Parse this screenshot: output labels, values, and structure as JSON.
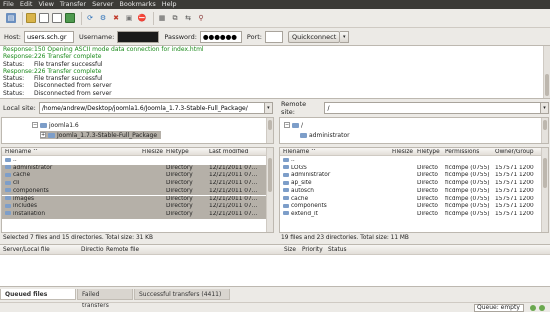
{
  "menu": [
    "File",
    "Edit",
    "View",
    "Transfer",
    "Server",
    "Bookmarks",
    "Help"
  ],
  "toolbar_icons": [
    "site-manager-icon",
    "toggle-log-icon",
    "toggle-local-tree-icon",
    "toggle-remote-tree-icon",
    "toggle-queue-icon",
    "refresh-icon",
    "process-queue-icon",
    "cancel-icon",
    "disconnect-icon",
    "reconnect-icon",
    "filter-icon",
    "compare-icon",
    "sync-browse-icon",
    "search-icon"
  ],
  "quickconnect": {
    "host_label": "Host:",
    "host_value": "users.sch.gr",
    "username_label": "Username:",
    "username_value": "",
    "password_label": "Password:",
    "password_value": "●●●●●●",
    "port_label": "Port:",
    "port_value": "",
    "button_label": "Quickconnect",
    "dropdown": "▾"
  },
  "log": [
    {
      "type": "Response:",
      "text": "150 Opening ASCII mode data connection for index.html",
      "color": "green"
    },
    {
      "type": "Response:",
      "text": "226 Transfer complete",
      "color": "green"
    },
    {
      "type": "Status:",
      "text": "File transfer successful",
      "color": "plain"
    },
    {
      "type": "Response:",
      "text": "226 Transfer complete",
      "color": "green"
    },
    {
      "type": "Status:",
      "text": "File transfer successful",
      "color": "plain"
    },
    {
      "type": "Status:",
      "text": "Disconnected from server",
      "color": "plain"
    },
    {
      "type": "Status:",
      "text": "Disconnected from server",
      "color": "plain"
    }
  ],
  "local": {
    "label": "Local site:",
    "path": "/home/andrew/Desktop/joomla1.6/Joomla_1.7.3-Stable-Full_Package/",
    "tree": [
      {
        "name": "joomla1.6",
        "expander": "−"
      },
      {
        "name": "Joomla_1.7.3-Stable-Full_Package",
        "expander": "+"
      }
    ],
    "columns": [
      "Filename ^",
      "Filesize",
      "Filetype",
      "Last modified"
    ],
    "parent": "..",
    "rows": [
      {
        "name": "administrator",
        "type": "Directory",
        "modified": "12/21/2011 07..."
      },
      {
        "name": "cache",
        "type": "Directory",
        "modified": "12/21/2011 07..."
      },
      {
        "name": "cli",
        "type": "Directory",
        "modified": "12/21/2011 07..."
      },
      {
        "name": "components",
        "type": "Directory",
        "modified": "12/21/2011 07..."
      },
      {
        "name": "images",
        "type": "Directory",
        "modified": "12/21/2011 07..."
      },
      {
        "name": "includes",
        "type": "Directory",
        "modified": "12/21/2011 07..."
      },
      {
        "name": "installation",
        "type": "Directory",
        "modified": "12/21/2011 07..."
      }
    ],
    "status": "Selected 7 files and 15 directories. Total size: 31 KB"
  },
  "remote": {
    "label": "Remote site:",
    "path": "/",
    "tree": [
      {
        "name": "/",
        "expander": "−"
      },
      {
        "name": "administrator",
        "expander": ""
      }
    ],
    "columns": [
      "Filename ^",
      "Filesize",
      "Filetype",
      "Permissions",
      "Owner/Group"
    ],
    "parent": "..",
    "rows": [
      {
        "name": "LOGS",
        "type": "Directo",
        "perm": "flcdmpe (0755)",
        "owner": "157571 1200"
      },
      {
        "name": "administrator",
        "type": "Directo",
        "perm": "flcdmpe (0755)",
        "owner": "157571 1200"
      },
      {
        "name": "ap_site",
        "type": "Directo",
        "perm": "flcdmpe (0755)",
        "owner": "157571 1200"
      },
      {
        "name": "autosch",
        "type": "Directo",
        "perm": "flcdmpe (0755)",
        "owner": "157571 1200"
      },
      {
        "name": "cache",
        "type": "Directo",
        "perm": "flcdmpe (0755)",
        "owner": "157571 1200"
      },
      {
        "name": "components",
        "type": "Directo",
        "perm": "flcdmpe (0755)",
        "owner": "157571 1200"
      },
      {
        "name": "extend_it",
        "type": "Directo",
        "perm": "flcdmpe (0755)",
        "owner": "157571 1200"
      }
    ],
    "status": "19 files and 23 directories. Total size: 11 MB"
  },
  "queue": {
    "columns": [
      "Server/Local file",
      "Directio",
      "Remote file",
      "Size",
      "Priority",
      "Status"
    ]
  },
  "tabs": [
    "Queued files",
    "Failed transfers",
    "Successful transfers (4411)"
  ],
  "statusbar": {
    "queue": "Queue: empty"
  }
}
